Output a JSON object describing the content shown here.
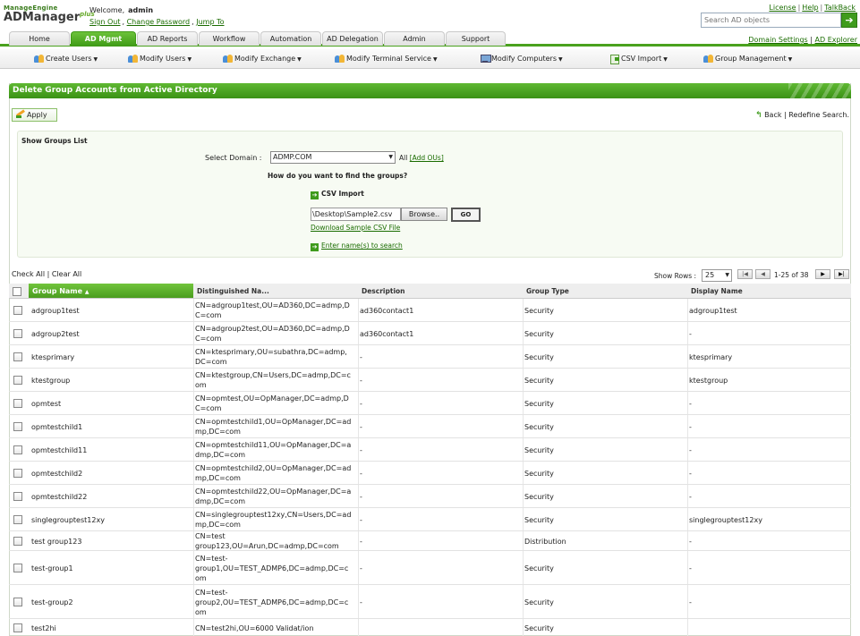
{
  "logo": {
    "line1": "ManageEngine",
    "line2": "ADManager",
    "plus": "plus"
  },
  "welcome": {
    "label": "Welcome,",
    "user": "admin",
    "links": [
      "Sign Out",
      "Change Password",
      "Jump To"
    ]
  },
  "toplinks": [
    "License",
    "Help",
    "TalkBack"
  ],
  "search": {
    "placeholder": "Search AD objects"
  },
  "tabs": [
    "Home",
    "AD Mgmt",
    "AD Reports",
    "Workflow",
    "Automation",
    "AD Delegation",
    "Admin",
    "Support"
  ],
  "active_tab": "AD Mgmt",
  "rightlinks": [
    "Domain Settings",
    "AD Explorer"
  ],
  "submenu": [
    "Create Users",
    "Modify Users",
    "Modify Exchange",
    "Modify Terminal Service",
    "Modify Computers",
    "CSV Import",
    "Group Management"
  ],
  "panel": {
    "title": "Delete Group Accounts from Active Directory"
  },
  "apply_label": "Apply",
  "back": {
    "back": "Back",
    "redefine": "Redefine Search."
  },
  "form": {
    "show_label": "Show Groups List",
    "domain_label": "Select Domain :",
    "domain_value": "ADMP.COM",
    "all_label": "All",
    "add_ous": "[Add OUs]",
    "how_label": "How do you want to find the groups?",
    "csv_label": "CSV Import",
    "file_value": "\\Desktop\\Sample2.csv",
    "browse_label": "Browse..",
    "go_label": "GO",
    "sample_link": "Download Sample CSV File",
    "enter_link": "Enter name(s) to search"
  },
  "checkall": {
    "check": "Check All",
    "clear": "Clear All"
  },
  "pagination": {
    "show_rows_label": "Show Rows :",
    "rows_value": "25",
    "info": "1-25 of 38"
  },
  "table": {
    "columns": [
      "Group Name",
      "Distinguished Na...",
      "Description",
      "Group Type",
      "Display Name"
    ],
    "rows": [
      {
        "name": "adgroup1test",
        "dn1": "CN=adgroup1test,OU=AD360,DC=admp,D",
        "dn2": "C=com",
        "desc": "ad360contact1",
        "type": "Security",
        "display": "adgroup1test"
      },
      {
        "name": "adgroup2test",
        "dn1": "CN=adgroup2test,OU=AD360,DC=admp,D",
        "dn2": "C=com",
        "desc": "ad360contact1",
        "type": "Security",
        "display": "-"
      },
      {
        "name": "ktesprimary",
        "dn1": "CN=ktesprimary,OU=subathra,DC=admp,",
        "dn2": "DC=com",
        "desc": "-",
        "type": "Security",
        "display": "ktesprimary"
      },
      {
        "name": "ktestgroup",
        "dn1": "CN=ktestgroup,CN=Users,DC=admp,DC=c",
        "dn2": "om",
        "desc": "-",
        "type": "Security",
        "display": "ktestgroup"
      },
      {
        "name": "opmtest",
        "dn1": "CN=opmtest,OU=OpManager,DC=admp,D",
        "dn2": "C=com",
        "desc": "-",
        "type": "Security",
        "display": "-"
      },
      {
        "name": "opmtestchild1",
        "dn1": "CN=opmtestchild1,OU=OpManager,DC=ad",
        "dn2": "mp,DC=com",
        "desc": "-",
        "type": "Security",
        "display": "-"
      },
      {
        "name": "opmtestchild11",
        "dn1": "CN=opmtestchild11,OU=OpManager,DC=a",
        "dn2": "dmp,DC=com",
        "desc": "-",
        "type": "Security",
        "display": "-"
      },
      {
        "name": "opmtestchild2",
        "dn1": "CN=opmtestchild2,OU=OpManager,DC=ad",
        "dn2": "mp,DC=com",
        "desc": "-",
        "type": "Security",
        "display": "-"
      },
      {
        "name": "opmtestchild22",
        "dn1": "CN=opmtestchild22,OU=OpManager,DC=a",
        "dn2": "dmp,DC=com",
        "desc": "-",
        "type": "Security",
        "display": "-"
      },
      {
        "name": "singlegrouptest12xy",
        "dn1": "CN=singlegrouptest12xy,CN=Users,DC=ad",
        "dn2": "mp,DC=com",
        "desc": "-",
        "type": "Security",
        "display": "singlegrouptest12xy"
      },
      {
        "name": "test group123",
        "dn1": "CN=test",
        "dn2": "group123,OU=Arun,DC=admp,DC=com",
        "desc": "-",
        "type": "Distribution",
        "display": "-"
      },
      {
        "name": "test-group1",
        "dn1": "CN=test-",
        "dn2": "group1,OU=TEST_ADMP6,DC=admp,DC=c",
        "dn3": "om",
        "desc": "-",
        "type": "Security",
        "display": "-"
      },
      {
        "name": "test-group2",
        "dn1": "CN=test-",
        "dn2": "group2,OU=TEST_ADMP6,DC=admp,DC=c",
        "dn3": "om",
        "desc": "-",
        "type": "Security",
        "display": "-"
      },
      {
        "name": "test2hi",
        "dn1": "CN=test2hi,OU=6000 Validat/ion",
        "dn2": "",
        "desc": "",
        "type": "Security",
        "display": ""
      }
    ]
  }
}
